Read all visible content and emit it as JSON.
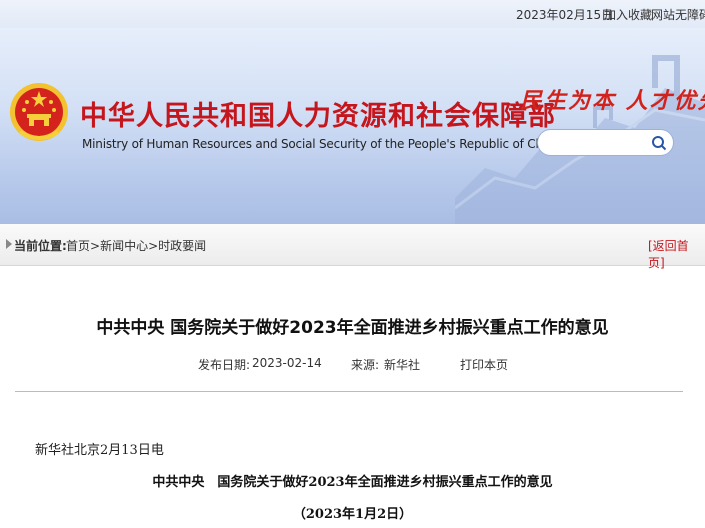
{
  "topbar": {
    "date": "2023年02月15日",
    "favorite": "加入收藏",
    "accessibility": "网站无障碍"
  },
  "header": {
    "title_cn": "中华人民共和国人力资源和社会保障部",
    "title_en": "Ministry of Human Resources and Social Security of the People's Republic of China",
    "slogan": "民生为本  人才优先",
    "search_placeholder": ""
  },
  "breadcrumb": {
    "label": "当前位置:",
    "items": [
      "首页",
      "新闻中心",
      "时政要闻"
    ],
    "separator": ">",
    "back_home": "[返回首页]"
  },
  "article": {
    "title": "中共中央 国务院关于做好2023年全面推进乡村振兴重点工作的意见",
    "publish_label": "发布日期:",
    "publish_date": "2023-02-14",
    "source_label": "来源:",
    "source": "新华社",
    "print_label": "打印本页",
    "dateline": "新华社北京2月13日电",
    "body_title": "中共中央　国务院关于做好2023年全面推进乡村振兴重点工作的意见",
    "body_date": "（2023年1月2日）"
  },
  "colors": {
    "brand_red": "#c5161d",
    "banner_blue": "#b9cbec"
  }
}
